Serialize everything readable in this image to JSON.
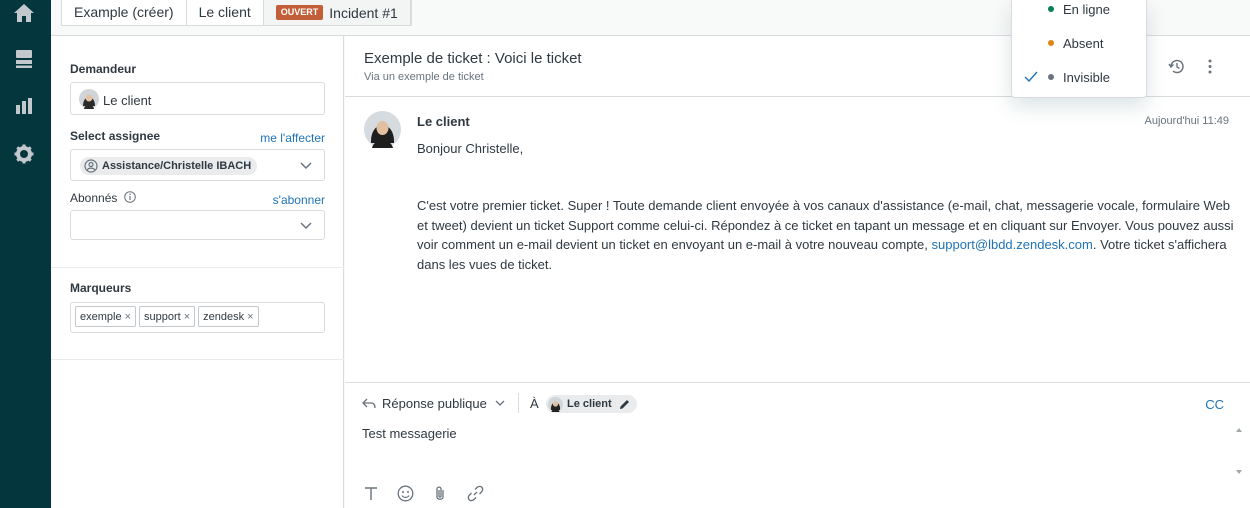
{
  "nav": {
    "items": [
      "home-icon",
      "views-icon",
      "reporting-icon",
      "admin-icon"
    ]
  },
  "tabs": [
    {
      "label": "Example (créer)"
    },
    {
      "label": "Le client"
    },
    {
      "badge": "OUVERT",
      "label": "Incident #1"
    }
  ],
  "sidebar": {
    "requester_label": "Demandeur",
    "requester_value": "Le client",
    "assignee_label": "Select assignee",
    "assign_me": "me l'affecter",
    "assignee_value": "Assistance/Christelle IBACH",
    "followers_label": "Abonnés",
    "follow_link": "s'abonner",
    "tags_label": "Marqueurs",
    "tags": [
      "exemple",
      "support",
      "zendesk"
    ]
  },
  "ticket": {
    "title": "Exemple de ticket : Voici le ticket",
    "via": "Via un exemple de ticket"
  },
  "message": {
    "author": "Le client",
    "time": "Aujourd'hui 11:49",
    "greeting": "Bonjour Christelle,",
    "body_pre": "C'est votre premier ticket. Super ! Toute demande client envoyée à vos canaux d'assistance (e-mail, chat, messagerie vocale, formulaire Web et tweet) devient un ticket Support comme celui-ci. Répondez à ce ticket en tapant un message et en cliquant sur Envoyer. Vous pouvez aussi voir comment un e-mail devient un ticket en envoyant un e-mail à votre nouveau compte,",
    "email": "support@lbdd.zendesk.com",
    "body_post": ". Votre ticket s'affichera dans les vues de ticket."
  },
  "composer": {
    "reply_type": "Réponse publique",
    "to_label": "À",
    "recipient": "Le client",
    "cc": "CC",
    "text": "Test messagerie"
  },
  "status_menu": {
    "items": [
      {
        "label": "En ligne",
        "color": "#038153"
      },
      {
        "label": "Absent",
        "color": "#e38215"
      },
      {
        "label": "Invisible",
        "color": "#68737d"
      }
    ],
    "selected": "Invisible"
  }
}
